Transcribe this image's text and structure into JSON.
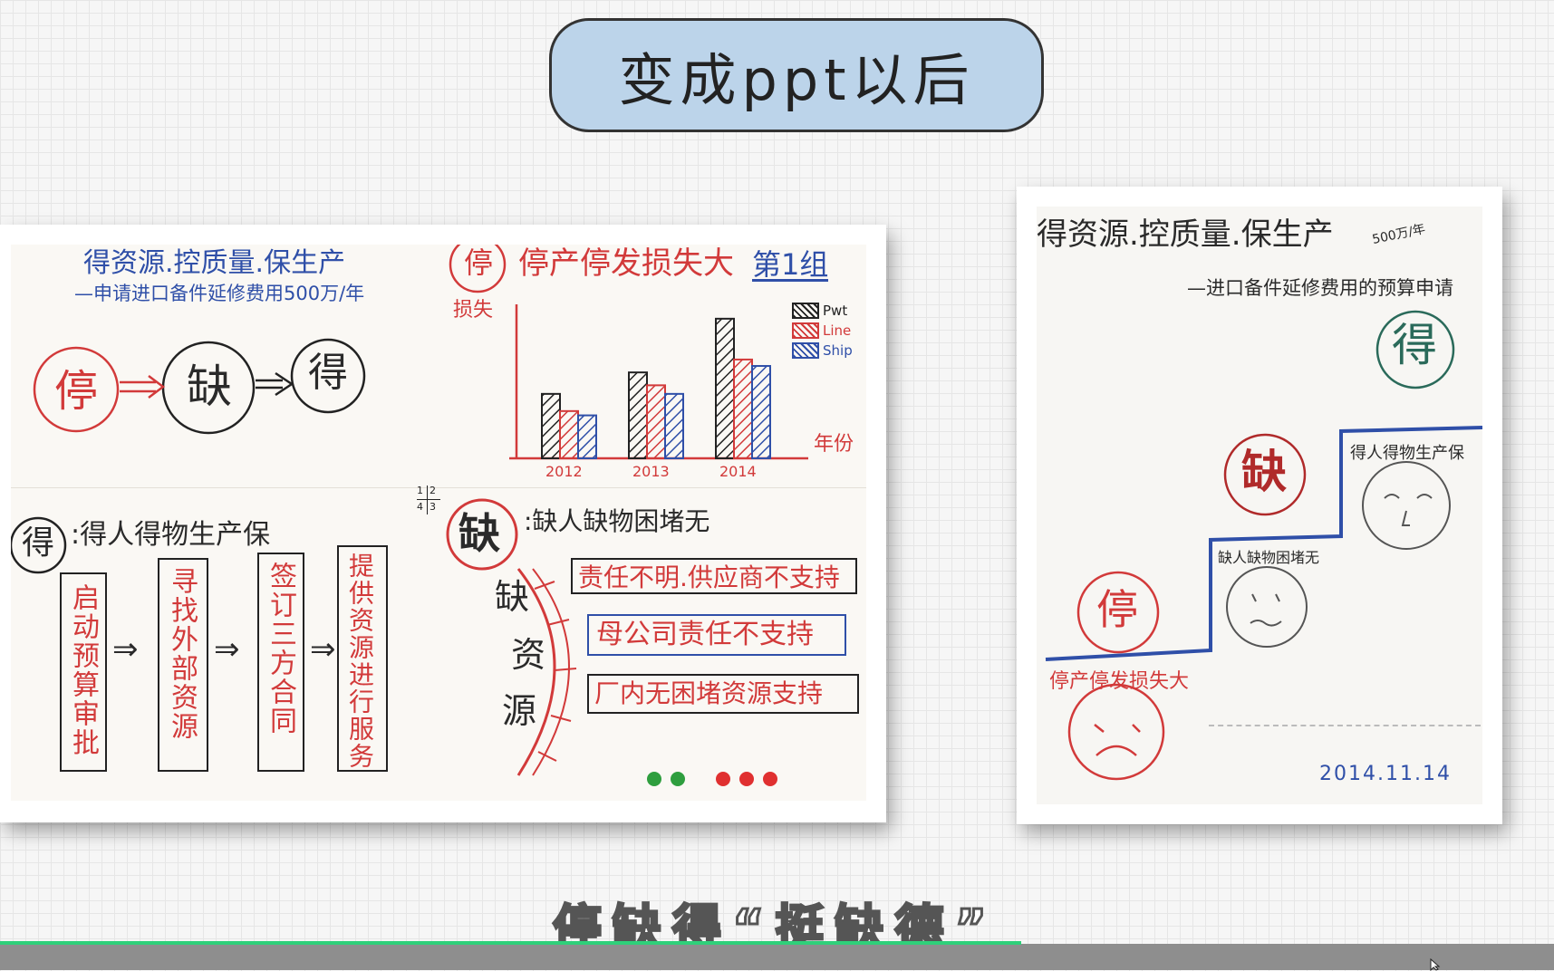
{
  "header": {
    "title": "变成ppt以后"
  },
  "left_photo": {
    "title": "得资源.控质量.保生产",
    "subtitle": "—申请进口备件延修费用500万/年",
    "flow_circles": [
      "停",
      "缺",
      "得"
    ],
    "chart_header_circle": "停",
    "chart_title": "停产停发损失大",
    "group_label": "第1组",
    "y_label": "损失",
    "x_label": "年份",
    "legend": [
      "Pwt",
      "Line",
      "Ship"
    ],
    "chart_data": {
      "type": "bar",
      "categories": [
        "2012",
        "2013",
        "2014"
      ],
      "series": [
        {
          "name": "Pwt",
          "values": [
            3,
            4,
            6.5
          ]
        },
        {
          "name": "Line",
          "values": [
            2.2,
            3.4,
            4.6
          ]
        },
        {
          "name": "Ship",
          "values": [
            2,
            3,
            4.3
          ]
        }
      ],
      "title": "停产停发损失大",
      "xlabel": "年份",
      "ylabel": "损失"
    },
    "quadrant_mark": [
      "1",
      "2",
      "4",
      "3"
    ],
    "de_section": {
      "circle": "得",
      "title": ":得人得物生产保",
      "steps": [
        "启动预算审批",
        "寻找外部资源",
        "签订三方合同",
        "提供资源进行服务"
      ]
    },
    "que_section": {
      "circle": "缺",
      "title": ":缺人缺物困堵无",
      "side_label": [
        "缺",
        "资",
        "源"
      ],
      "reasons": [
        "责任不明.供应商不支持",
        "母公司责任不支持",
        "厂内无困堵资源支持"
      ]
    },
    "dots": {
      "colors": [
        "#2e9e3e",
        "#2e9e3e",
        "#e03030",
        "#e03030",
        "#e03030"
      ]
    }
  },
  "right_photo": {
    "title": "得资源.控质量.保生产",
    "year_note": "500万/年",
    "subtitle": "—进口备件延修费用的预算申请",
    "circles": [
      "得",
      "缺",
      "停"
    ],
    "step_labels": [
      "得人得物生产保",
      "缺人缺物困堵无",
      "停产停发损失大"
    ],
    "date": "2014.11.14"
  },
  "caption": {
    "text": "停缺得“挺缺德”"
  },
  "colors": {
    "pill": "#bcd4ea",
    "progress": "#2fd07a",
    "red": "#d23a3a",
    "blue": "#2f4fa8"
  }
}
